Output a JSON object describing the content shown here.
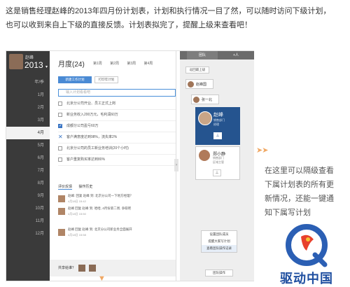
{
  "intro": {
    "line1": "这是销售经理赵峰的2013年四月份计划表，计划和执行情况一目了然，可以随时访问下级计划，",
    "line2": "也可以收到来自上下级的直接反馈。计划表拟完了，提醒上级来查看吧！"
  },
  "sidebar": {
    "user_name": "赵峰",
    "year": "2013",
    "months": [
      "年/季",
      "1月",
      "2月",
      "3月",
      "4月",
      "5月",
      "6月",
      "7月",
      "8月",
      "9月",
      "10月",
      "11月",
      "12月"
    ],
    "selected_month": "4月"
  },
  "main": {
    "title": "月度(24)",
    "weeks": [
      "第1周",
      "第2周",
      "第3周",
      "第4周"
    ],
    "primary_button": "新建工作计划",
    "secondary_button": "打印年计划",
    "new_task_placeholder": "输入计划看看吧",
    "tasks": [
      {
        "text": "北京分公司开业、员工正式上岗",
        "state": "open"
      },
      {
        "text": "新业务收入200万元，毛利润60万",
        "state": "open"
      },
      {
        "text": "成都分公司盈亏60万",
        "state": "done"
      },
      {
        "text": "客户满意度达到98%，流失率2%",
        "state": "cancel"
      },
      {
        "text": "北京分公司的员工新业务培训(20个小时)",
        "state": "open"
      },
      {
        "text": "客户重复购买率达到80%",
        "state": "open"
      }
    ],
    "feedback_tabs": [
      "评价反馈",
      "操作历史"
    ],
    "comments": [
      {
        "line1": "赵峰: 回复 赵峰 到: 北京分公司一下地方经理？",
        "line2": "4月18日 15:42"
      },
      {
        "line1": "赵峰 回复 赵峰 到: 哈哈, 4月份第二周, 争取吧",
        "line2": "4月18日 15:50"
      },
      {
        "line1": "赵峰 回复 赵峰 到: 北京分公司新业务全面展开",
        "line2": "4月18日 15:58"
      }
    ],
    "share_label": "共享给谁？"
  },
  "right_panel": {
    "tabs": [
      "团队",
      "+人"
    ],
    "back_button": "返回最上级",
    "people": [
      {
        "name": "赵峰国"
      },
      {
        "name": "张一北"
      }
    ],
    "selected_card": {
      "name": "赵峰",
      "dept": "销售部门",
      "role": "经理"
    },
    "other_card": {
      "name": "郑小静",
      "dept": "销售部门",
      "role": "区域主管"
    },
    "menu_items": [
      "设置团队成员",
      "提醒大家写计划",
      "查看团队操作记录"
    ],
    "ops_button": "团队操作"
  },
  "callout": {
    "lines": [
      "在这里可以隔级查看",
      "下属计划表的所有更",
      "新情况，还能一键通",
      "知下属写计划"
    ]
  },
  "watermark": {
    "text": "驱动中国"
  }
}
